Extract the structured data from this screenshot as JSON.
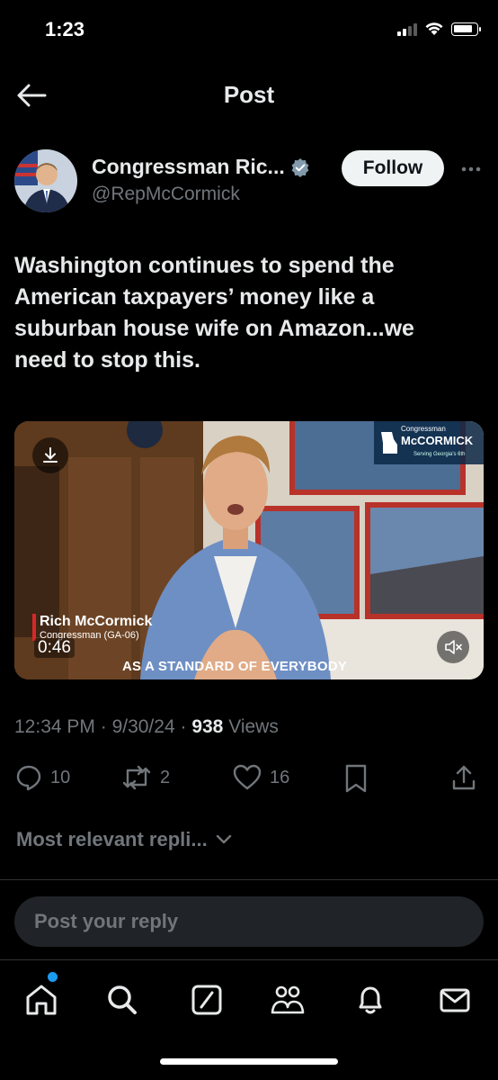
{
  "status_bar": {
    "time": "1:23",
    "icons": [
      "signal-icon",
      "wifi-icon",
      "battery-icon"
    ]
  },
  "header": {
    "title": "Post",
    "back_icon": "arrow-left-icon"
  },
  "author": {
    "display_name": "Congressman Ric...",
    "handle": "@RepMcCormick",
    "verified": true,
    "follow_label": "Follow",
    "more_icon": "more-horizontal-icon"
  },
  "tweet": {
    "text": "Washington continues to spend the American taxpayers’ money like a suburban house wife on Amazon...we need to stop this."
  },
  "video": {
    "brand_small": "Congressman",
    "brand_main": "McCORMICK",
    "brand_sub": "Serving Georgia's 6th",
    "lower_third_name": "Rich McCormick",
    "lower_third_title": "Congressman (GA-06)",
    "duration": "0:46",
    "caption": "AS A STANDARD OF EVERYBODY",
    "download_icon": "download-icon",
    "mute_icon": "speaker-muted-icon"
  },
  "meta": {
    "time": "12:34 PM",
    "date": "9/30/24",
    "views_count": "938",
    "views_label": "Views"
  },
  "actions": {
    "replies": "10",
    "reposts": "2",
    "likes": "16"
  },
  "replies_sort": {
    "label": "Most relevant repli...",
    "icon": "chevron-down-icon"
  },
  "reply_box": {
    "placeholder": "Post your reply"
  },
  "nav": {
    "items": [
      "home-icon",
      "search-icon",
      "grok-icon",
      "communities-icon",
      "notifications-icon",
      "messages-icon"
    ],
    "accent": "#1d9bf0"
  },
  "colors": {
    "background": "#000000",
    "text": "#e7e9ea",
    "secondary": "#71767b",
    "accent": "#1d9bf0"
  }
}
